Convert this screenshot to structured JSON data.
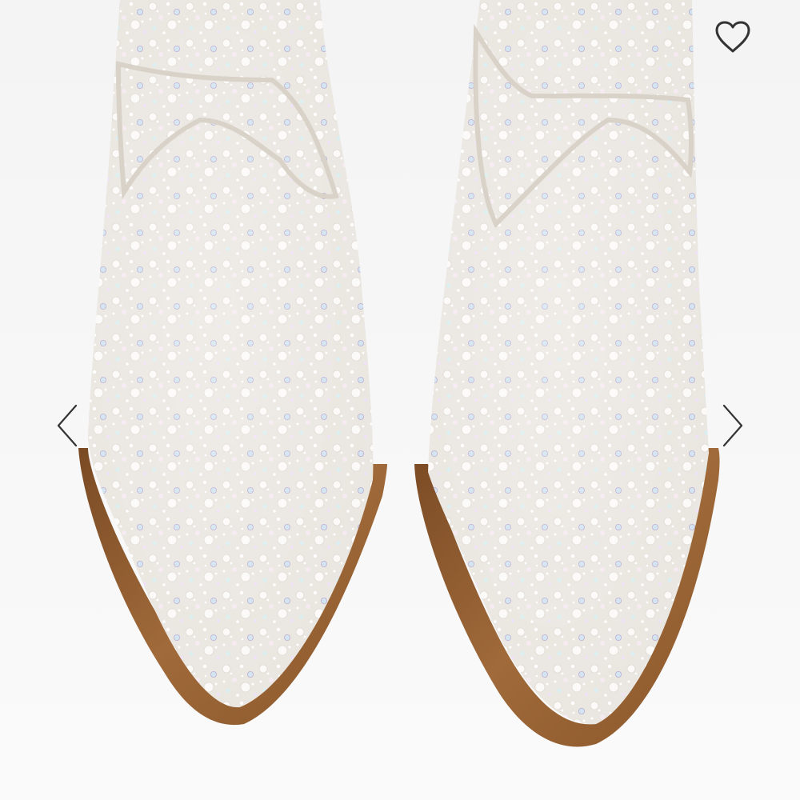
{
  "viewer": {
    "image_subject": "rhinestone-pearl-embellished-pointed-toe-western-ankle-boots",
    "colors": {
      "background": "#f7f7f7",
      "boot_upper": "#e7e3dd",
      "sole": "#8c5a2e",
      "icon_stroke": "#333333"
    }
  },
  "controls": {
    "prev_icon": "chevron-left-icon",
    "next_icon": "chevron-right-icon",
    "favorite_icon": "heart-outline-icon"
  }
}
